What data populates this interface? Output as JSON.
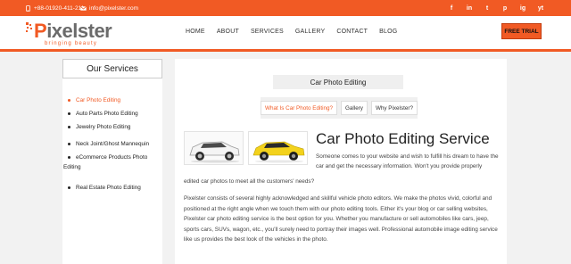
{
  "topbar": {
    "phone": "+88-01920-411-211",
    "email": "info@pixelster.com",
    "social": [
      "f",
      "in",
      "t",
      "p",
      "ig",
      "yt"
    ],
    "social_names": [
      "facebook-icon",
      "linkedin-icon",
      "twitter-icon",
      "pinterest-icon",
      "instagram-icon",
      "youtube-icon"
    ]
  },
  "header": {
    "logo_text": "ixelster",
    "logo_p": "P",
    "logo_tagline": "bringing beauty",
    "nav": [
      "HOME",
      "ABOUT",
      "SERVICES",
      "GALLERY",
      "CONTACT",
      "BLOG"
    ],
    "free_trial": "FREE TRIAL"
  },
  "sidebar": {
    "title": "Our Services",
    "items": [
      {
        "label": "Car Photo Editing"
      },
      {
        "label": "Auto Parts Photo Editing"
      },
      {
        "label": "Jewelry Photo Editing"
      },
      {
        "label": "Neck Joint/Ghost Mannequin"
      },
      {
        "label": "eCommerce Products Photo",
        "label2": "Editing"
      },
      {
        "label": "Real Estate Photo Editing"
      }
    ]
  },
  "main": {
    "page_title": "Car Photo Editing",
    "tabs": [
      "What Is Car Photo Editing?",
      "Gallery",
      "Why Pixelster?"
    ],
    "service_title": "Car Photo Editing Service",
    "para1": "Someone comes to your website and wish to fulfill his dream to have the car and get the necessary information. Won't you provide properly",
    "para1b": "edited car photos to meet all the customers' needs?",
    "para2": "Pixelster consists of several highly acknowledged and skillful vehicle photo editors. We make the photos vivid, colorful and positioned at the right angle when we touch them with our photo editing tools. Either it's your blog or car selling websites, Pixelster car photo editing service is the best option for you. Whether you manufacture or sell automobiles like cars, jeep, sports cars, SUVs, wagon, etc., you'll surely need to portray their images well. Professional automobile image editing service like us provides the best look of the vehicles in the photo."
  },
  "colors": {
    "accent": "#f15a24"
  }
}
